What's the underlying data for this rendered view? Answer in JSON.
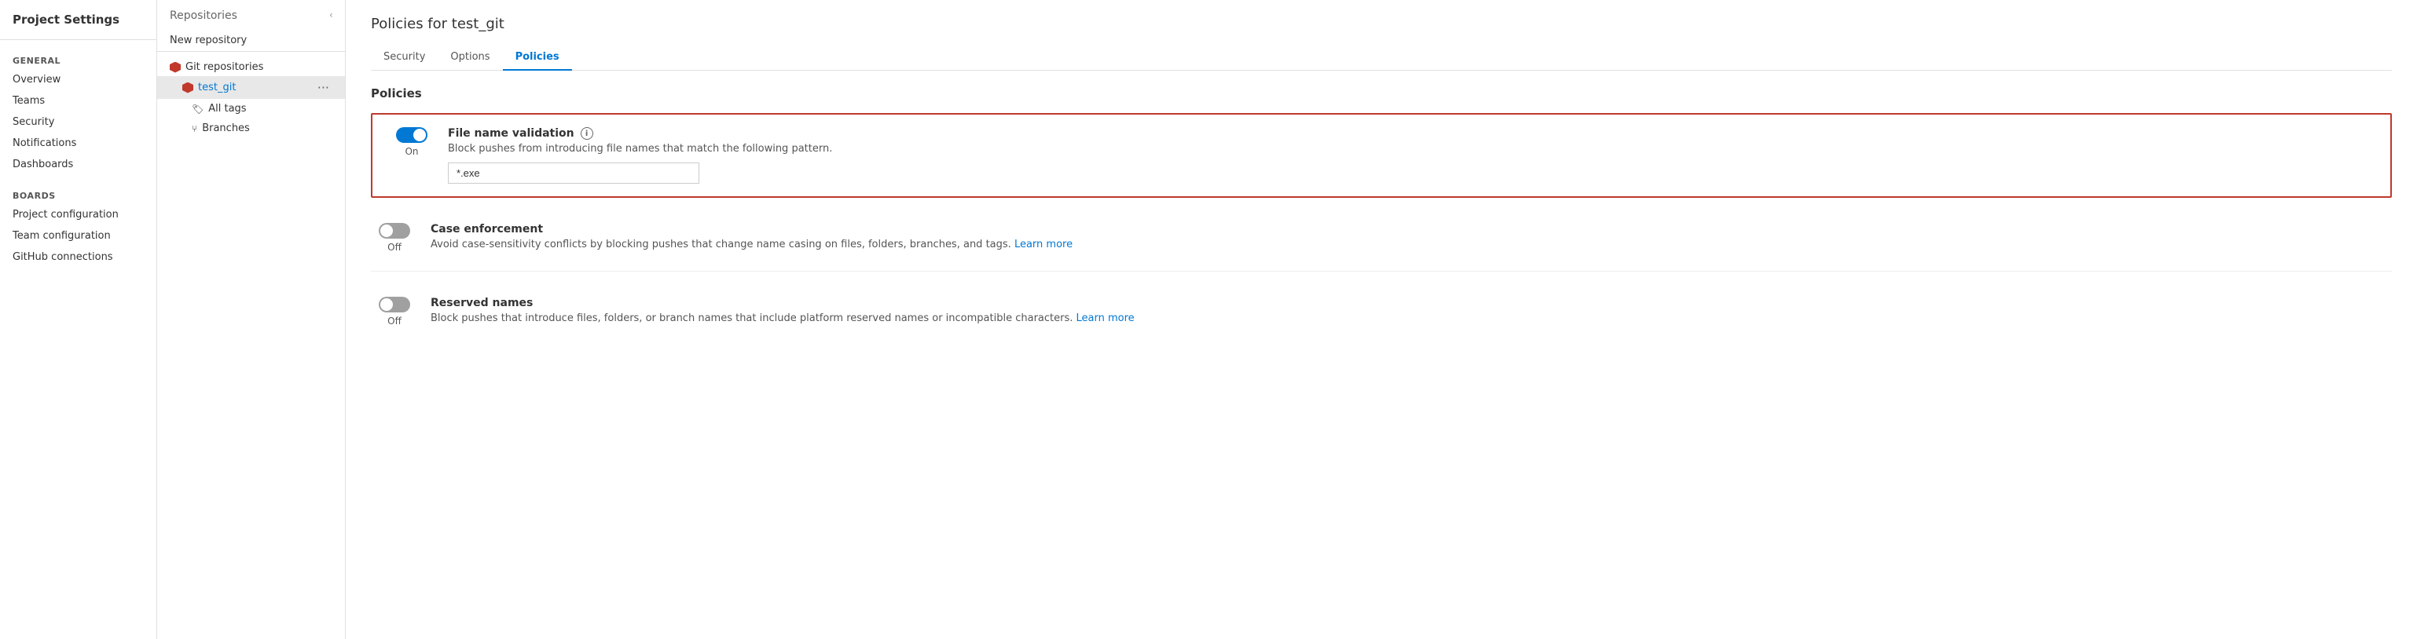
{
  "sidebar": {
    "title": "Project Settings",
    "sections": [
      {
        "header": "General",
        "items": [
          {
            "id": "overview",
            "label": "Overview"
          },
          {
            "id": "teams",
            "label": "Teams"
          },
          {
            "id": "security",
            "label": "Security"
          },
          {
            "id": "notifications",
            "label": "Notifications"
          },
          {
            "id": "dashboards",
            "label": "Dashboards"
          }
        ]
      },
      {
        "header": "Boards",
        "items": [
          {
            "id": "project-configuration",
            "label": "Project configuration"
          },
          {
            "id": "team-configuration",
            "label": "Team configuration"
          },
          {
            "id": "github-connections",
            "label": "GitHub connections"
          }
        ]
      }
    ]
  },
  "panel": {
    "title": "Repositories",
    "new_repo_label": "New repository",
    "repo_group_label": "Git repositories",
    "repos": [
      {
        "id": "test_git",
        "label": "test_git",
        "active": true
      }
    ],
    "sub_items": [
      {
        "id": "all-tags",
        "label": "All tags",
        "icon": "tag"
      },
      {
        "id": "branches",
        "label": "Branches",
        "icon": "branch"
      }
    ]
  },
  "main": {
    "page_title": "Policies for test_git",
    "tabs": [
      {
        "id": "security",
        "label": "Security",
        "active": false
      },
      {
        "id": "options",
        "label": "Options",
        "active": false
      },
      {
        "id": "policies",
        "label": "Policies",
        "active": true
      }
    ],
    "policies_heading": "Policies",
    "policies": [
      {
        "id": "file-name-validation",
        "name": "File name validation",
        "toggle_state": "on",
        "toggle_label_on": "On",
        "toggle_label_off": "",
        "description": "Block pushes from introducing file names that match the following pattern.",
        "has_input": true,
        "input_value": "*.exe",
        "input_placeholder": "*.exe",
        "has_learn_more": false,
        "highlighted": true
      },
      {
        "id": "case-enforcement",
        "name": "Case enforcement",
        "toggle_state": "off",
        "toggle_label_on": "",
        "toggle_label_off": "Off",
        "description": "Avoid case-sensitivity conflicts by blocking pushes that change name casing on files, folders, branches, and tags.",
        "has_input": false,
        "learn_more_label": "Learn more",
        "has_learn_more": true,
        "highlighted": false
      },
      {
        "id": "reserved-names",
        "name": "Reserved names",
        "toggle_state": "off",
        "toggle_label_on": "",
        "toggle_label_off": "Off",
        "description": "Block pushes that introduce files, folders, or branch names that include platform reserved names or incompatible characters.",
        "has_input": false,
        "learn_more_label": "Learn more",
        "has_learn_more": true,
        "highlighted": false
      }
    ]
  }
}
